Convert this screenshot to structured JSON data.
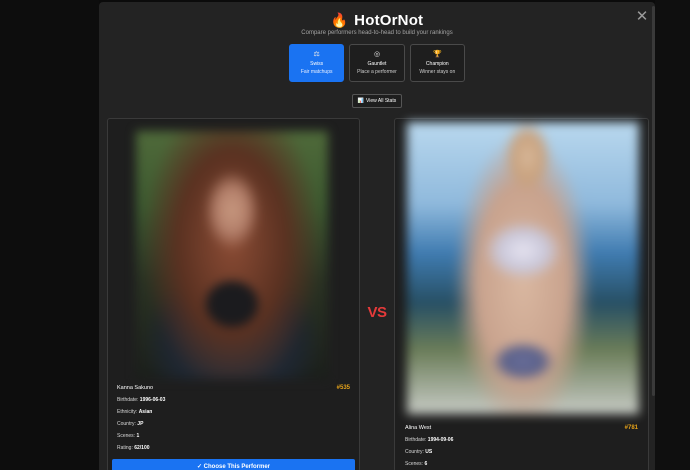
{
  "header": {
    "title": "HotOrNot",
    "subtitle": "Compare performers head-to-head to build your rankings",
    "close_symbol": "✕"
  },
  "modes": [
    {
      "name": "Swiss",
      "desc": "Fair matchups",
      "icon": "⚖",
      "active": true
    },
    {
      "name": "Gauntlet",
      "desc": "Place a performer",
      "icon": "◎",
      "active": false
    },
    {
      "name": "Champion",
      "desc": "Winner stays on",
      "icon": "🏆",
      "active": false
    }
  ],
  "stats_button": {
    "icon": "📊",
    "label": "View All Stats"
  },
  "vs_label": "VS",
  "left_performer": {
    "name": "Kanna Sakuno",
    "rank": "#535",
    "birthdate_label": "Birthdate:",
    "birthdate": "1996-06-03",
    "ethnicity_label": "Ethnicity:",
    "ethnicity": "Asian",
    "country_label": "Country:",
    "country": "JP",
    "scenes_label": "Scenes:",
    "scenes": "1",
    "rating_label": "Rating:",
    "rating": "62/100",
    "choose_label": "✓ Choose This Performer"
  },
  "right_performer": {
    "name": "Alina West",
    "rank": "#781",
    "birthdate_label": "Birthdate:",
    "birthdate": "1994-09-06",
    "country_label": "Country:",
    "country": "US",
    "scenes_label": "Scenes:",
    "scenes": "6"
  },
  "colors": {
    "accent": "#1a73f2",
    "rank": "#e5a21a",
    "vs": "#e53a3a",
    "modal_bg": "#232323"
  }
}
